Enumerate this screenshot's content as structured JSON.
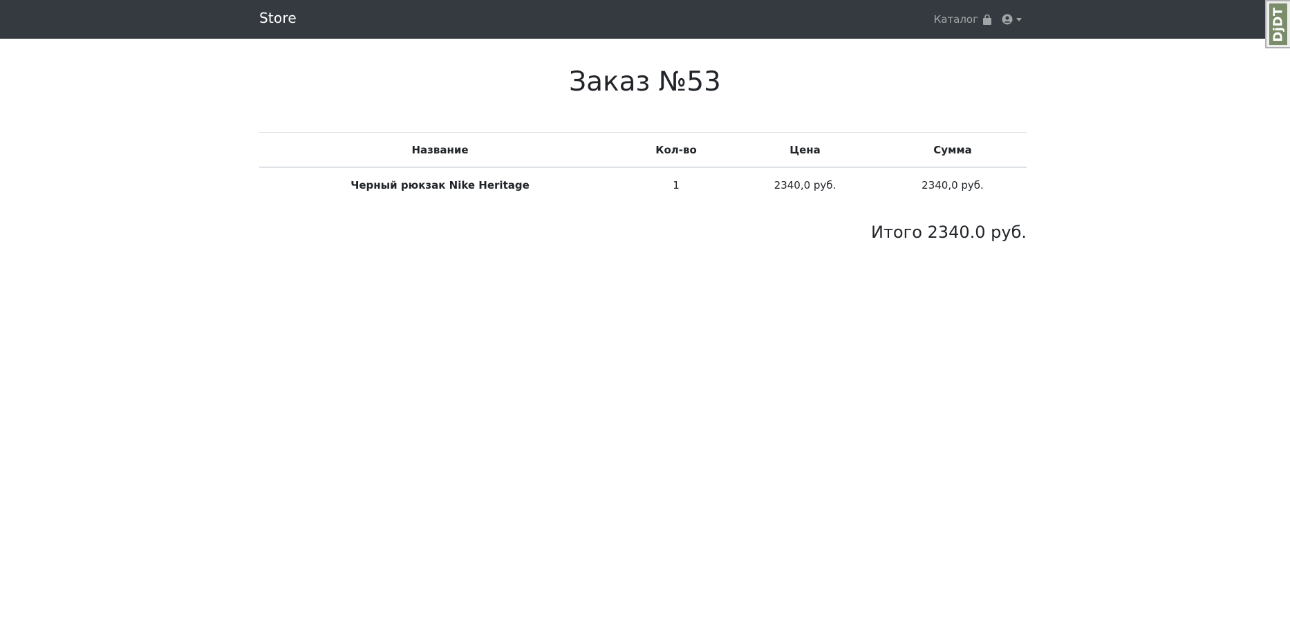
{
  "navbar": {
    "brand": "Store",
    "catalog_label": "Каталог",
    "catalog_icon": "shopping-bag-icon",
    "user_icon": "user-circle-icon",
    "background": "#343a40"
  },
  "debug_toolbar": {
    "label": "DjDT"
  },
  "order": {
    "title": "Заказ №53",
    "columns": [
      "Название",
      "Кол-во",
      "Цена",
      "Сумма"
    ],
    "rows": [
      {
        "name": "Черный рюкзак Nike Heritage",
        "quantity": "1",
        "price": "2340,0 руб.",
        "sum": "2340,0 руб."
      }
    ],
    "total": "Итого 2340.0 руб."
  }
}
